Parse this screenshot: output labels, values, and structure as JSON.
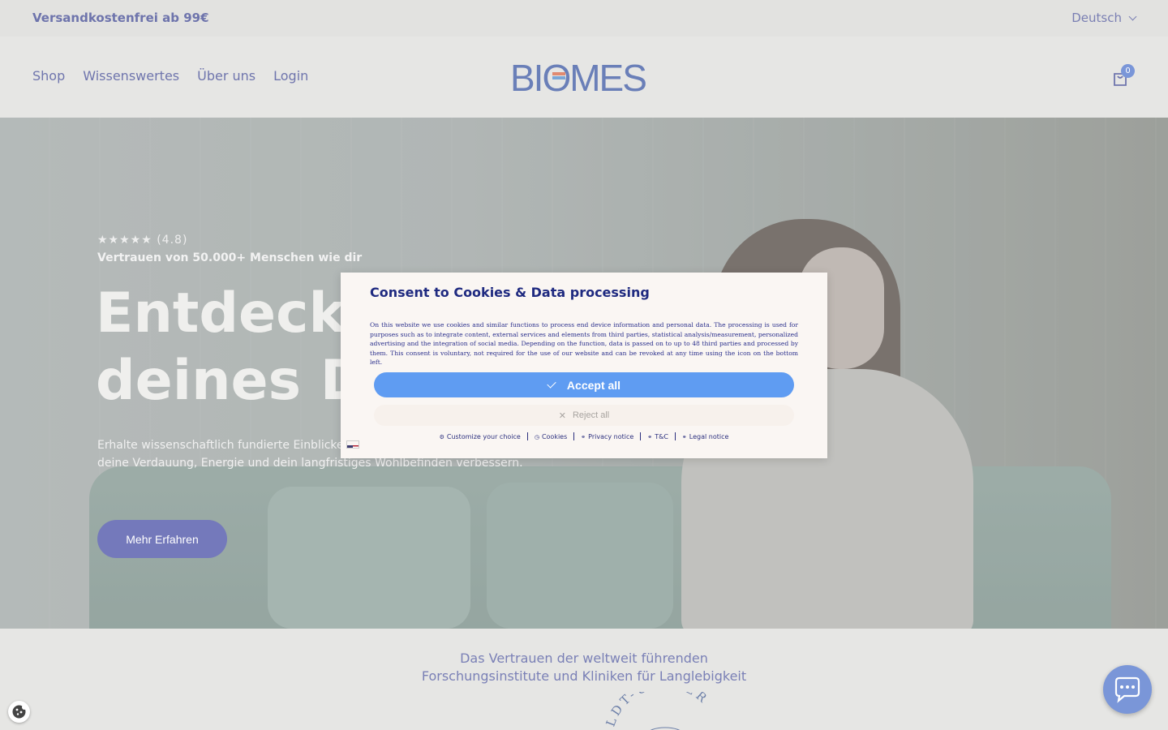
{
  "topbar": {
    "promo": "Versandkostenfrei ab 99€",
    "language": "Deutsch"
  },
  "nav": {
    "shop": "Shop",
    "knowledge": "Wissenswertes",
    "about": "Über uns",
    "login": "Login"
  },
  "logo": {
    "text": "BIOMES"
  },
  "cart": {
    "count": "0"
  },
  "hero": {
    "stars": "★★★★★",
    "rating": "(4.8)",
    "trust": "Vertrauen von 50.000+ Menschen wie dir",
    "headline_line1": "Entdecke",
    "headline_line2": "deines Da",
    "subtext": "Erhalte wissenschaftlich fundierte Einblicke in Lebensmittel und Gewohnheiten deine Verdauung, Energie und dein langfristiges Wohlbefinden verbessern.",
    "cta": "Mehr Erfahren"
  },
  "trust_section": {
    "line1": "Das Vertrauen der weltweit führenden",
    "line2": "Forschungsinstitute und Kliniken für Langlebigkeit",
    "seal_text": "OLDT-UNIVER"
  },
  "consent": {
    "title": "Consent to Cookies & Data processing",
    "body": "On this website we use cookies and similar functions to process end device information and personal data. The processing is used for purposes such as to integrate content, external services and elements from third parties, statistical analysis/measurement, personalized advertising and the integration of social media. Depending on the function, data is passed on to up to 48 third parties and processed by them. This consent is voluntary, not required for the use of our website and can be revoked at any time using the icon on the bottom left.",
    "accept": "Accept all",
    "reject": "Reject all",
    "links": [
      "Customize your choice",
      "Cookies",
      "Privacy notice",
      "T&C",
      "Legal notice"
    ]
  },
  "colors": {
    "accent": "#7479bb",
    "consent_accept": "#5f9cf2",
    "consent_title": "#1f2a80"
  }
}
